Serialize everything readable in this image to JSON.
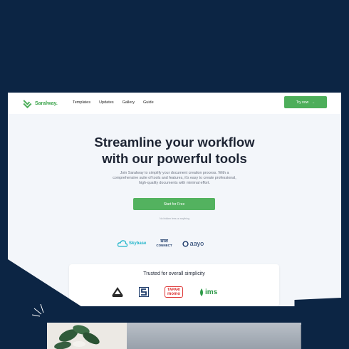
{
  "brand": {
    "name": "Saralway.",
    "accent": "#4dae5a"
  },
  "nav": {
    "links": [
      "Templates",
      "Updates",
      "Gallery",
      "Guide"
    ],
    "try_label": "Try now"
  },
  "hero": {
    "title_line1": "Streamline your workflow",
    "title_line2": "with our powerful tools",
    "subtitle": "Join Saralway to simplify your document creation process. With a comprehensive suite of tools and features, it's easy to create professional, high-quality documents with minimal effort.",
    "cta_label": "Start for Free",
    "note": "No hidden fees or anything"
  },
  "partners": {
    "skybase": "Skybase",
    "connect_top": "सरल",
    "connect_bottom": "CONNECT",
    "aayo": "aayo"
  },
  "trust": {
    "title": "Trusted for overall simplicity",
    "tapari_top": "TAPARI",
    "tapari_bottom": "momo",
    "ims": "ims"
  }
}
